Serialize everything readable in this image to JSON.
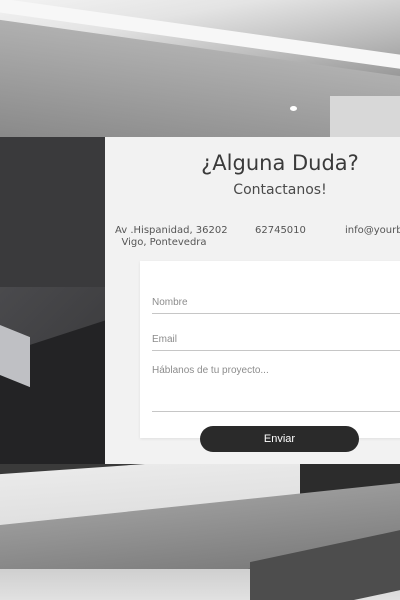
{
  "contact": {
    "title": "¿Alguna Duda?",
    "subtitle": "Contactanos!",
    "address_line1": "Av .Hispanidad, 36202",
    "address_line2": "Vigo, Pontevedra",
    "phone": "62745010",
    "email": "info@yourbe"
  },
  "form": {
    "name_placeholder": "Nombre",
    "email_placeholder": "Email",
    "message_placeholder": "Háblanos de tu proyecto...",
    "submit_label": "Enviar"
  },
  "colors": {
    "card_bg": "#f2f2f2",
    "button_bg": "#2a2a2a",
    "side_panel": "#3a3a3c"
  }
}
